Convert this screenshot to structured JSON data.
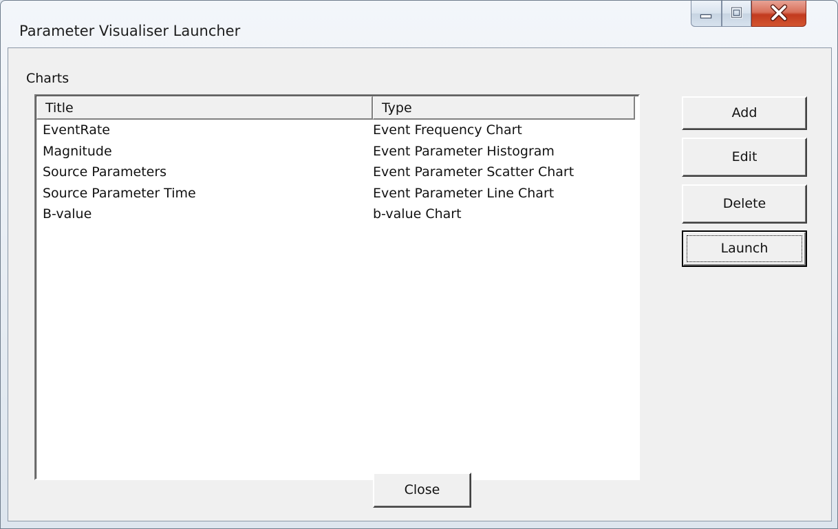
{
  "window": {
    "title": "Parameter Visualiser Launcher",
    "controls": [
      "minimize-icon",
      "maximize-icon",
      "close-icon"
    ]
  },
  "charts_group": {
    "label": "Charts",
    "columns": [
      "Title",
      "Type"
    ],
    "rows": [
      {
        "title": "EventRate",
        "type": "Event Frequency Chart"
      },
      {
        "title": "Magnitude",
        "type": "Event Parameter Histogram"
      },
      {
        "title": "Source Parameters",
        "type": "Event Parameter Scatter Chart"
      },
      {
        "title": "Source Parameter Time",
        "type": "Event Parameter Line Chart"
      },
      {
        "title": "B-value",
        "type": "b-value Chart"
      }
    ]
  },
  "buttons": {
    "add": "Add",
    "edit": "Edit",
    "delete": "Delete",
    "launch": "Launch",
    "close": "Close"
  },
  "colors": {
    "close_button": "#c9472a",
    "dialog_face": "#f0f0f0"
  }
}
